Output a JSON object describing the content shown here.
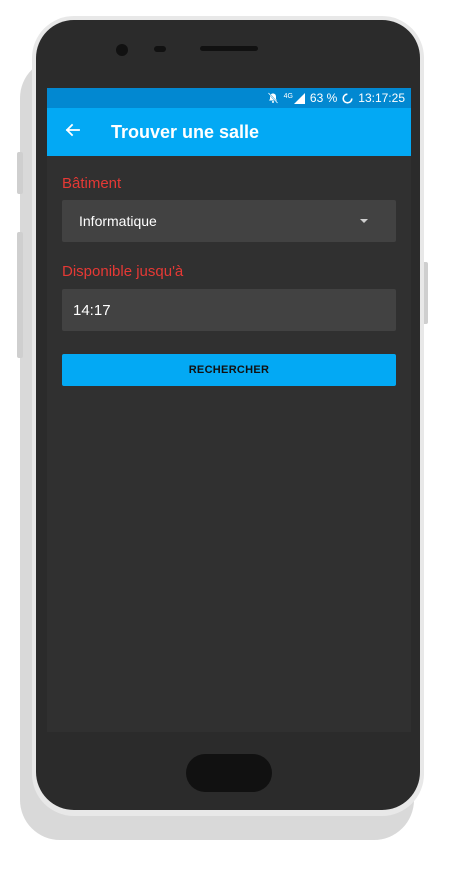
{
  "status_bar": {
    "network": "4G",
    "battery": "63 %",
    "time": "13:17:25",
    "icons": [
      "bell-off-icon",
      "signal-icon",
      "battery-loading-icon"
    ]
  },
  "app_bar": {
    "title": "Trouver une salle",
    "back_icon": "arrow-left-icon"
  },
  "form": {
    "building_label": "Bâtiment",
    "building_value": "Informatique",
    "available_label": "Disponible jusqu'à",
    "available_value": "14:17",
    "search_button": "RECHERCHER"
  },
  "colors": {
    "status_bar": "#0288d1",
    "app_bar": "#03a9f4",
    "background": "#303030",
    "field": "#424242",
    "label": "#e53935",
    "button": "#03a9f4"
  }
}
